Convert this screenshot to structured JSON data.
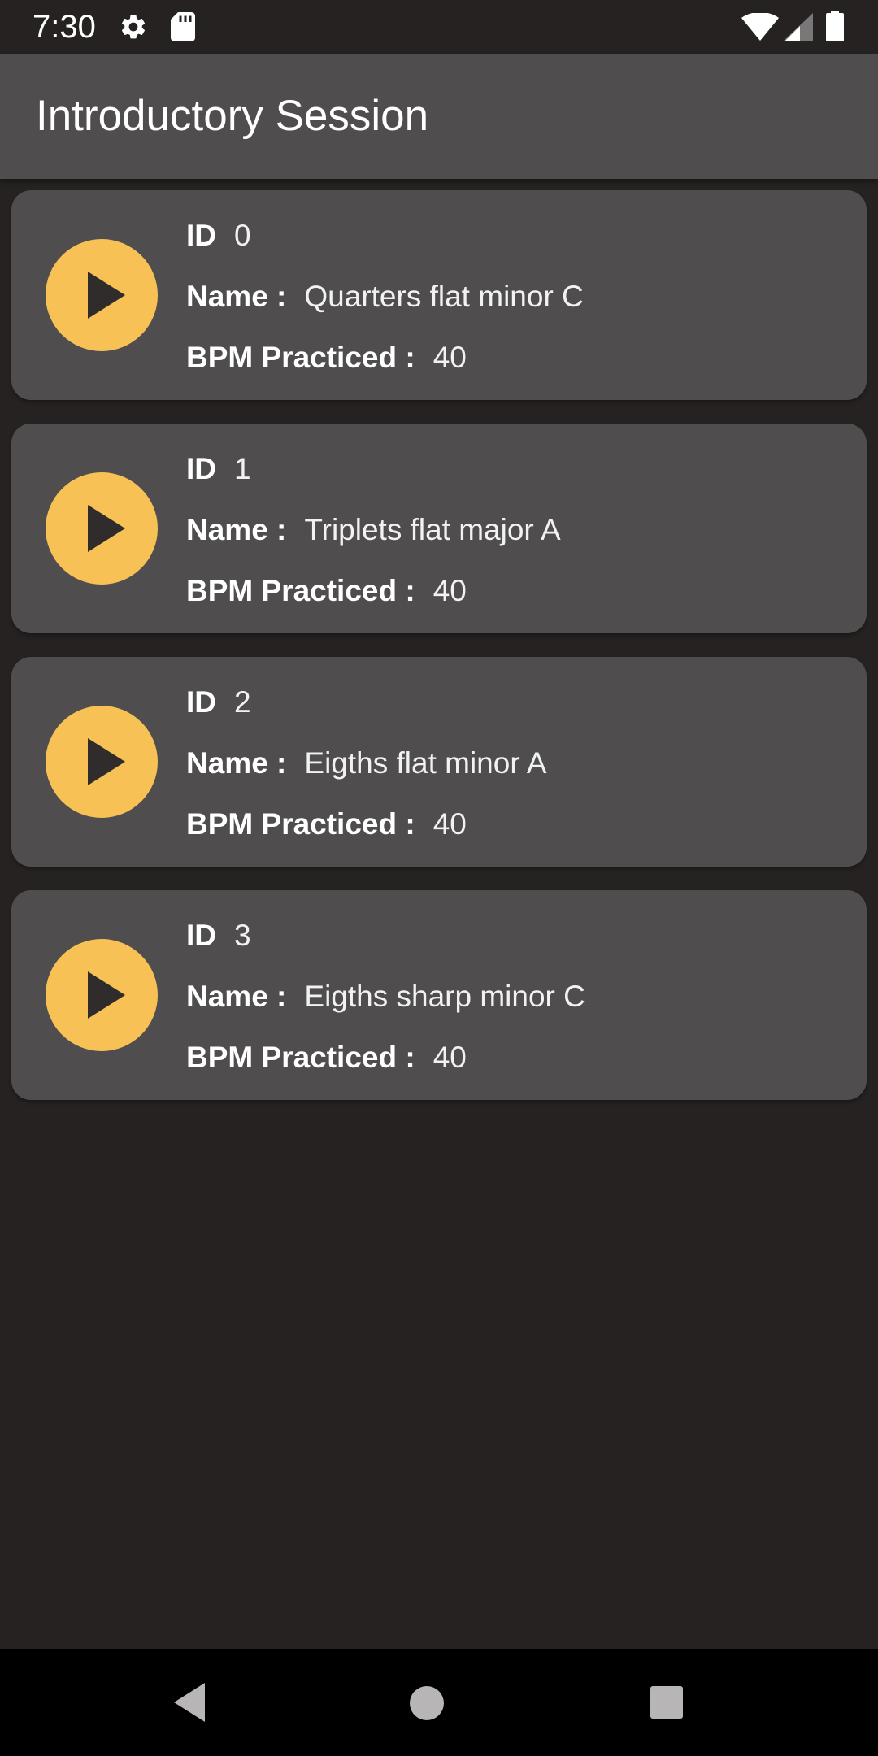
{
  "status_bar": {
    "time": "7:30",
    "icons": [
      "gear-icon",
      "sd-card-icon",
      "wifi-icon",
      "signal-icon",
      "battery-icon"
    ]
  },
  "app_bar": {
    "title": "Introductory Session"
  },
  "labels": {
    "id": "ID",
    "name": "Name :",
    "bpm": "BPM Practiced :"
  },
  "items": [
    {
      "id": "0",
      "name": "Quarters flat minor C",
      "bpm": "40"
    },
    {
      "id": "1",
      "name": "Triplets flat major A",
      "bpm": "40"
    },
    {
      "id": "2",
      "name": "Eigths flat minor A",
      "bpm": "40"
    },
    {
      "id": "3",
      "name": "Eigths sharp minor C",
      "bpm": "40"
    }
  ],
  "colors": {
    "background": "#262222",
    "surface": "#4f4d4e",
    "accent": "#f7c155",
    "play_glyph": "#302c2c"
  },
  "nav_bar": {
    "icons": [
      "back-icon",
      "home-icon",
      "recents-icon"
    ]
  }
}
